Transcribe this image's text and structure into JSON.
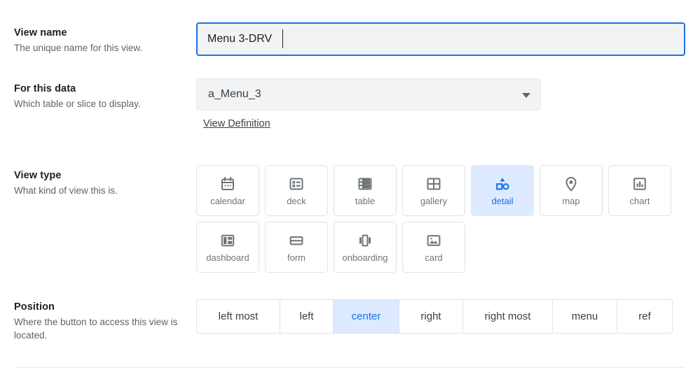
{
  "view_name": {
    "title": "View name",
    "description": "The unique name for this view.",
    "value": "Menu 3-DRV",
    "placeholder": ""
  },
  "for_this_data": {
    "title": "For this data",
    "description": "Which table or slice to display.",
    "selected": "a_Menu_3",
    "link_label": "View Definition",
    "dropdown_icon": "chevron-down-icon"
  },
  "view_type": {
    "title": "View type",
    "description": "What kind of view this is.",
    "selected": "detail",
    "rows": [
      [
        {
          "label": "calendar",
          "icon": "calendar-icon"
        },
        {
          "label": "deck",
          "icon": "deck-icon"
        },
        {
          "label": "table",
          "icon": "table-icon"
        },
        {
          "label": "gallery",
          "icon": "gallery-icon"
        },
        {
          "label": "detail",
          "icon": "detail-icon"
        },
        {
          "label": "map",
          "icon": "map-pin-icon"
        },
        {
          "label": "chart",
          "icon": "chart-icon"
        }
      ],
      [
        {
          "label": "dashboard",
          "icon": "dashboard-icon"
        },
        {
          "label": "form",
          "icon": "form-icon"
        },
        {
          "label": "onboarding",
          "icon": "onboarding-icon"
        },
        {
          "label": "card",
          "icon": "card-icon"
        }
      ]
    ]
  },
  "position": {
    "title": "Position",
    "description": "Where the button to access this view is located.",
    "selected": "center",
    "options": [
      "left most",
      "left",
      "center",
      "right",
      "right most",
      "menu",
      "ref"
    ]
  },
  "colors": {
    "accent": "#1a73e8",
    "selected_bg": "#ddeaff",
    "field_bg": "#f1f3f4",
    "icon_gray": "#6e7579",
    "border": "#e0e2e5",
    "text_primary": "#202124",
    "text_secondary": "#5f6368"
  }
}
